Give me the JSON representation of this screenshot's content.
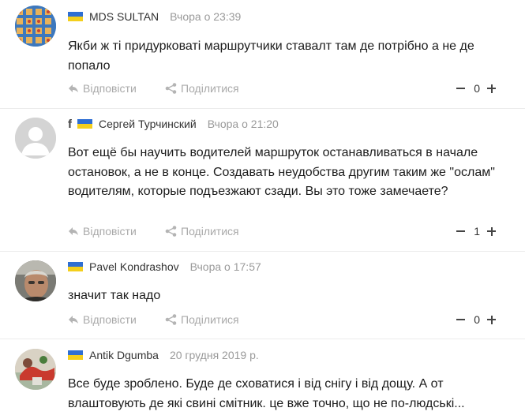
{
  "comments": [
    {
      "author": "MDS SULTAN",
      "date": "Вчора о 23:39",
      "text": "Якби ж ті придурковаті маршрутчики ставалт там де потрібно а не де попало",
      "reply_label": "Відповісти",
      "share_label": "Поділитися",
      "score": "0"
    },
    {
      "author": "Сергей Турчинский",
      "date": "Вчора о 21:20",
      "text": "Вот ещё бы научить водителей маршруток останавливаться в начале остановок, а не в конце. Создавать неудобства другим таким же \"ослам\" водителям, которые подъезжают сзади. Вы это тоже замечаете?",
      "reply_label": "Відповісти",
      "share_label": "Поділитися",
      "score": "1",
      "via": "f"
    },
    {
      "author": "Pavel Kondrashov",
      "date": "Вчора о 17:57",
      "text": "значит так надо",
      "reply_label": "Відповісти",
      "share_label": "Поділитися",
      "score": "0"
    },
    {
      "author": "Antik Dgumba",
      "date": "20 грудня 2019 р.",
      "text": "Все буде зроблено. Буде де сховатися і від снігу і від дощу. А от влаштовують де які свині смітник. це вже точно, що не по-людські...",
      "reply_label": "",
      "share_label": "",
      "score": ""
    }
  ],
  "colors": {
    "flag_blue": "#2f6fd3",
    "flag_yellow": "#f4cf1c",
    "muted_text": "#a9a9a9"
  }
}
